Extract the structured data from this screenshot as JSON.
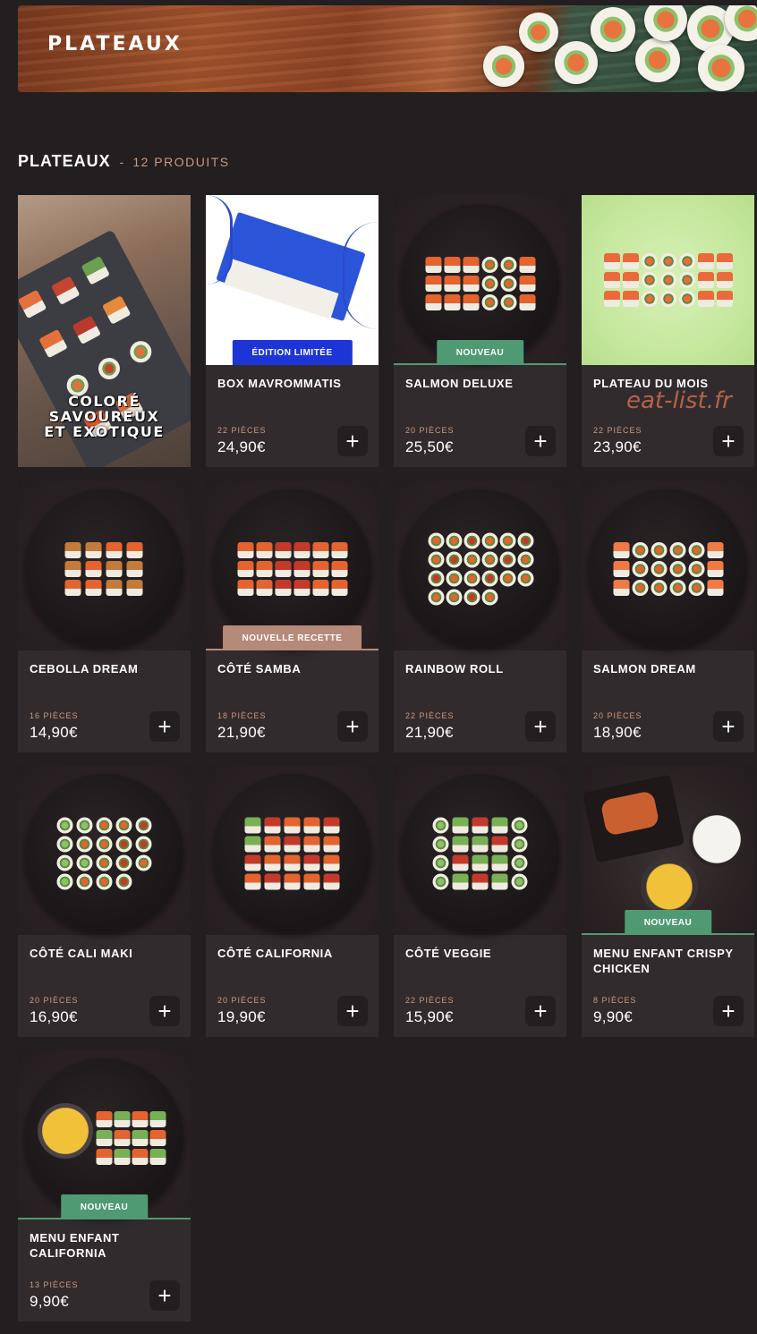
{
  "banner": {
    "title": "PLATEAUX"
  },
  "section": {
    "title": "PLATEAUX",
    "separator": "-",
    "count": "12 PRODUITS"
  },
  "promo": {
    "lines": [
      "COLORÉ",
      "SAVOUREUX",
      "ET EXOTIQUE"
    ]
  },
  "watermark": "eat-list.fr",
  "add_icon": "plus-icon",
  "colors": {
    "background": "#231e20",
    "card": "#322b2d",
    "accent": "#c99a7f",
    "badge_green": "#4f9a73",
    "badge_blue": "#1d35d6",
    "badge_tan": "#b58a78"
  },
  "products": [
    {
      "name": "BOX MAVROMMATIS",
      "pieces": "22 PIÈCES",
      "price": "24,90€",
      "badge": "ÉDITION LIMITÉE"
    },
    {
      "name": "SALMON DELUXE",
      "pieces": "20 PIÈCES",
      "price": "25,50€",
      "badge": "NOUVEAU"
    },
    {
      "name": "PLATEAU DU MOIS",
      "pieces": "22 PIÈCES",
      "price": "23,90€",
      "badge": ""
    },
    {
      "name": "CEBOLLA DREAM",
      "pieces": "16 PIÈCES",
      "price": "14,90€",
      "badge": ""
    },
    {
      "name": "CÔTÉ SAMBA",
      "pieces": "18 PIÈCES",
      "price": "21,90€",
      "badge": "NOUVELLE RECETTE"
    },
    {
      "name": "RAINBOW ROLL",
      "pieces": "22 PIÈCES",
      "price": "21,90€",
      "badge": ""
    },
    {
      "name": "SALMON DREAM",
      "pieces": "20 PIÈCES",
      "price": "18,90€",
      "badge": ""
    },
    {
      "name": "CÔTÉ CALI MAKI",
      "pieces": "20 PIÈCES",
      "price": "16,90€",
      "badge": ""
    },
    {
      "name": "CÔTÉ CALIFORNIA",
      "pieces": "20 PIÈCES",
      "price": "19,90€",
      "badge": ""
    },
    {
      "name": "CÔTÉ VEGGIE",
      "pieces": "22 PIÈCES",
      "price": "15,90€",
      "badge": ""
    },
    {
      "name": "MENU ENFANT CRISPY CHICKEN",
      "pieces": "8 PIÈCES",
      "price": "9,90€",
      "badge": "NOUVEAU"
    },
    {
      "name": "MENU ENFANT CALIFORNIA",
      "pieces": "13 PIÈCES",
      "price": "9,90€",
      "badge": "NOUVEAU"
    }
  ]
}
